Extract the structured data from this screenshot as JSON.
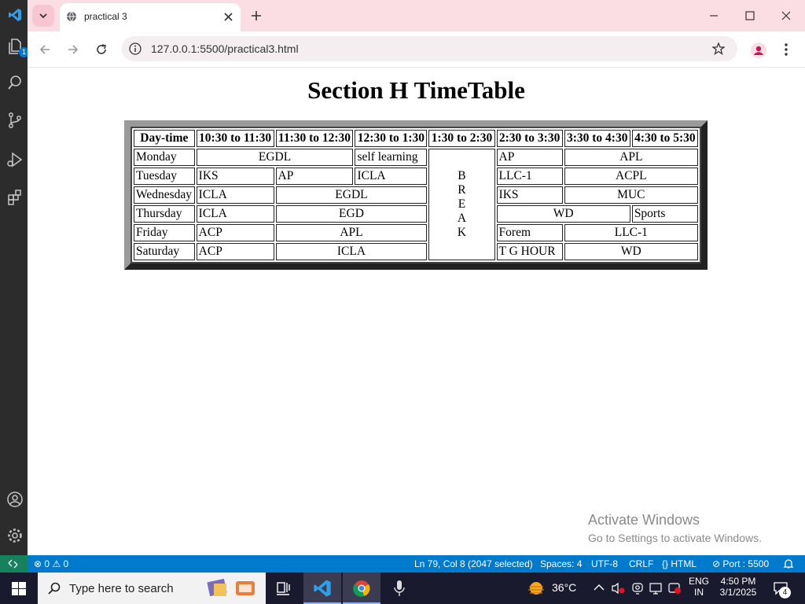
{
  "browser": {
    "tab_title": "practical 3",
    "url": "127.0.0.1:5500/practical3.html"
  },
  "vscode": {
    "explorer_badge": "1"
  },
  "page": {
    "title": "Section H TimeTable",
    "headers": [
      "Day-time",
      "10:30 to 11:30",
      "11:30 to 12:30",
      "12:30 to 1:30",
      "1:30 to 2:30",
      "2:30 to 3:30",
      "3:30 to 4:30",
      "4:30 to 5:30"
    ],
    "break_letters": [
      "B",
      "R",
      "E",
      "A",
      "K"
    ],
    "rows": {
      "monday": {
        "day": "Monday",
        "c1": "EGDL",
        "c2": "self learning",
        "c3": "AP",
        "c4": "APL"
      },
      "tuesday": {
        "day": "Tuesday",
        "c1": "IKS",
        "c2": "AP",
        "c3": "ICLA",
        "c4": "LLC-1",
        "c5": "ACPL"
      },
      "wednesday": {
        "day": "Wednesday",
        "c1": "ICLA",
        "c2": "EGDL",
        "c3": "IKS",
        "c4": "MUC"
      },
      "thursday": {
        "day": "Thursday",
        "c1": "ICLA",
        "c2": "EGD",
        "c3": "WD",
        "c4": "Sports"
      },
      "friday": {
        "day": "Friday",
        "c1": "ACP",
        "c2": "APL",
        "c3": "Forem",
        "c4": "LLC-1"
      },
      "saturday": {
        "day": "Saturday",
        "c1": "ACP",
        "c2": "ICLA",
        "c3": "T G HOUR",
        "c4": "WD"
      }
    }
  },
  "watermark": {
    "line1": "Activate Windows",
    "line2": "Go to Settings to activate Windows."
  },
  "statusbar": {
    "errors": "0",
    "warnings": "0",
    "position": "Ln 79, Col 8 (2047 selected)",
    "spaces": "Spaces: 4",
    "encoding": "UTF-8",
    "eol": "CRLF",
    "language": "HTML",
    "port": "Port : 5500"
  },
  "taskbar": {
    "search_placeholder": "Type here to search",
    "temperature": "36°C",
    "lang1": "ENG",
    "lang2": "IN",
    "time": "4:50 PM",
    "date": "3/1/2025",
    "notifications": "4"
  }
}
